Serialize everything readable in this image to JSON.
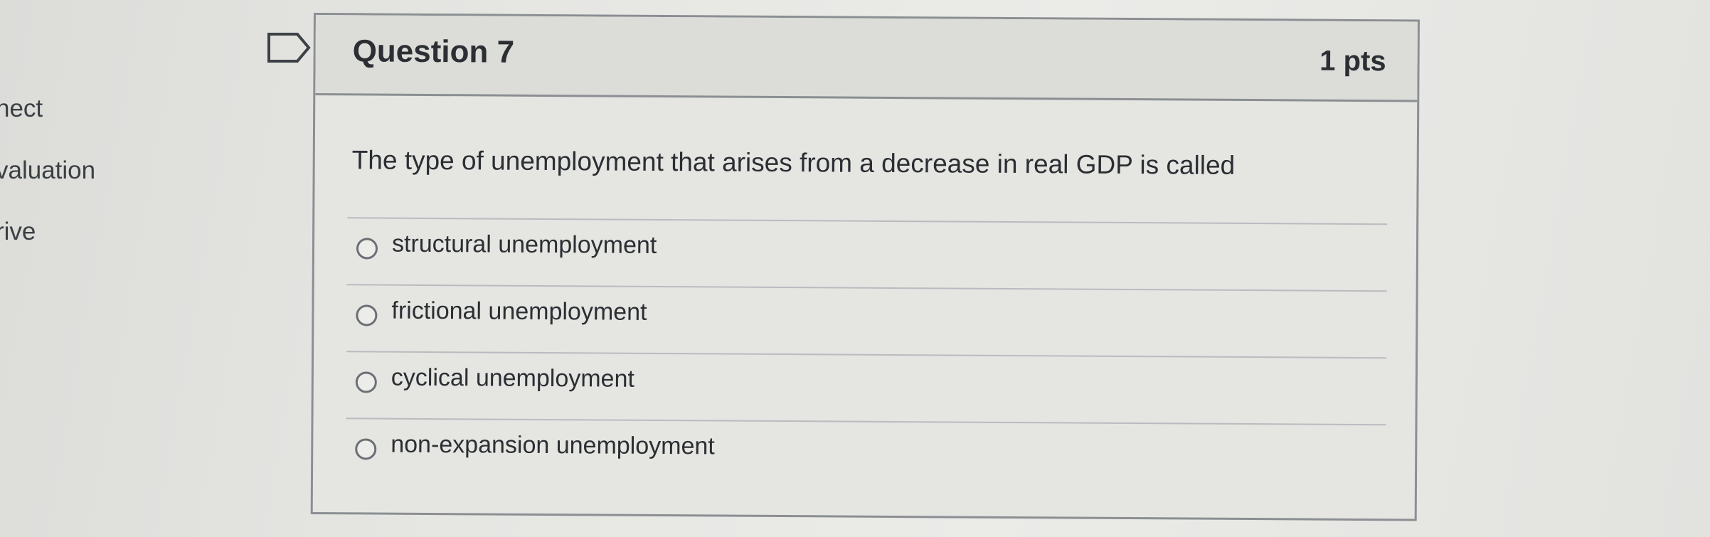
{
  "sidebar": {
    "items": [
      {
        "label": "nect"
      },
      {
        "label": "valuation"
      },
      {
        "label": "rive"
      }
    ]
  },
  "question": {
    "title": "Question 7",
    "points": "1 pts",
    "text": "The type of unemployment that arises from a decrease in real GDP is called",
    "answers": [
      {
        "label": "structural unemployment"
      },
      {
        "label": "frictional unemployment"
      },
      {
        "label": "cyclical unemployment"
      },
      {
        "label": "non-expansion unemployment"
      }
    ]
  },
  "icons": {
    "bookmark": "bookmark-flag-icon",
    "radio": "radio-button-unselected"
  },
  "colors": {
    "border": "#8b8f93",
    "text": "#2b2f33",
    "header_bg": "#dcdcd9",
    "body_bg": "#e5e5e2"
  }
}
